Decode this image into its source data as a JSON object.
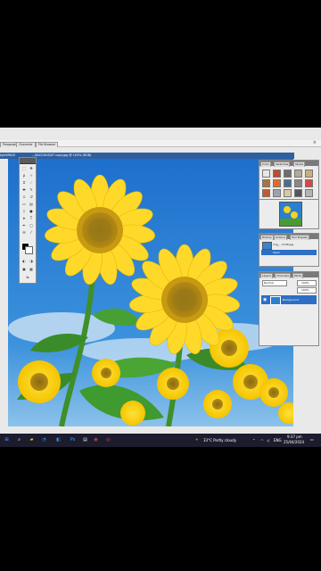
{
  "doc_tabs": [
    "Paragraph",
    "Character",
    "File Browser"
  ],
  "document_title": "...BACCHUS/07 copy.jpg @ 103% (RGB)",
  "left_title": "tyleSPACE",
  "panels": {
    "swatches_tabs": [
      "Color",
      "Swatches",
      "Styles"
    ],
    "history_tabs": [
      "History",
      "Actions",
      "Tool Presets"
    ],
    "history_items": [
      "img_...1108.jpg",
      "Open"
    ],
    "layers_tabs": [
      "Layers",
      "Channels",
      "Paths"
    ],
    "layers_blend": "Normal",
    "layers_opacity": "100%",
    "layers_fill": "100%",
    "layer_name": "Background"
  },
  "taskbar": {
    "weather": "33°C  Partly cloudy",
    "lang": "ENG",
    "time": "9:37 pm",
    "date": "25/04/2024"
  },
  "colors": {
    "sky": "#2a7fd0",
    "accent": "#2d6fc5",
    "taskbar": "#1c1c2e"
  }
}
